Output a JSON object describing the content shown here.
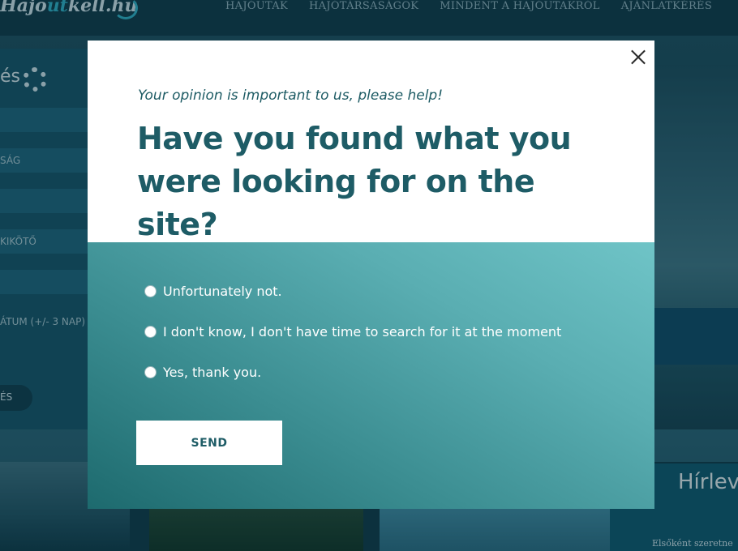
{
  "site": {
    "logo_text": "Hajo",
    "logo_accent": "ut",
    "logo_suffix": "kell.hu",
    "nav": [
      "HAJÓUTAK",
      "HAJÓTÁRSASÁGOK",
      "MINDENT A HAJÓUTAKRÓL",
      "AJÁNLATKÉRÉS"
    ],
    "sidebar": {
      "title": "és",
      "fields": [
        "",
        "SÁG",
        "",
        "KIKÖTŐ",
        ""
      ],
      "date_field": "ÁTUM (+/- 3 NAP)",
      "button": "ÉS"
    },
    "newsletter_heading": "Hírlev",
    "newsletter_text": "Elsőként szeretne"
  },
  "modal": {
    "subtitle": "Your opinion is important to us, please help!",
    "title": "Have you found what you were looking for on the site?",
    "options": [
      "Unfortunately not.",
      "I don't know, I don't have time to search for it at the moment",
      "Yes, thank you."
    ],
    "send_label": "SEND",
    "close_icon": "close-icon"
  },
  "colors": {
    "title": "#1e5c66",
    "panel_gradient_start": "#1d6a6e",
    "panel_gradient_end": "#6fc4c7"
  }
}
